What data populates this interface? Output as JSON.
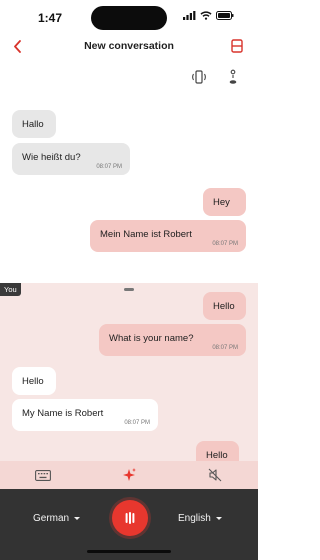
{
  "status": {
    "time": "1:47"
  },
  "header": {
    "title": "New conversation"
  },
  "conversation_top": [
    {
      "side": "left",
      "text": "Hallo",
      "time": ""
    },
    {
      "side": "left",
      "text": "Wie heißt du?",
      "time": "08:07 PM"
    },
    {
      "side": "right",
      "text": "Hey",
      "time": ""
    },
    {
      "side": "right",
      "text": "Mein Name ist Robert",
      "time": "08:07 PM"
    }
  ],
  "you_panel": {
    "tag": "You",
    "messages": [
      {
        "side": "right",
        "text": "Hello",
        "time": ""
      },
      {
        "side": "right",
        "text": "What is your name?",
        "time": "08:07 PM"
      },
      {
        "side": "left",
        "text": "Hello",
        "time": ""
      },
      {
        "side": "left",
        "text": "My Name is Robert",
        "time": "08:07 PM"
      },
      {
        "side": "right",
        "text": "Hello",
        "time": ""
      }
    ]
  },
  "bottom": {
    "source_lang": "German",
    "target_lang": "English"
  },
  "colors": {
    "accent": "#e8372e",
    "bubble_right": "#f4c8c4",
    "bubble_left": "#e7e7e7",
    "panel_bg": "#f7e6e4"
  },
  "icons": [
    "chevron-left-icon",
    "split-view-icon",
    "phone-rotate-icon",
    "person-stand-icon",
    "keyboard-icon",
    "sparkle-icon",
    "speaker-muted-icon",
    "waveform-icon"
  ]
}
